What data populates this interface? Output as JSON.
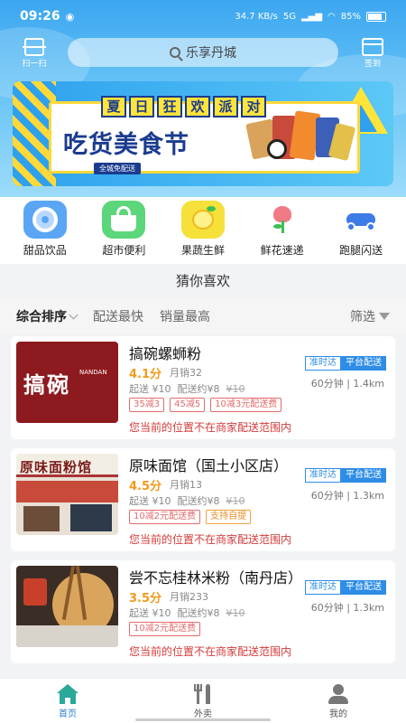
{
  "status": {
    "time": "09:26",
    "speed": "34.7 KB/s",
    "network": "5G",
    "battery": "85%"
  },
  "header": {
    "scan_label": "扫一扫",
    "search_placeholder": "乐享丹城",
    "sign_label": "签到"
  },
  "banner": {
    "summer_chars": [
      "夏",
      "日",
      "狂",
      "欢",
      "派",
      "对"
    ],
    "title": "吃货美食节",
    "tag": "全城免配送"
  },
  "categories": [
    {
      "label": "甜品饮品",
      "icon": "donut-icon",
      "color": "#5aa6f5"
    },
    {
      "label": "超市便利",
      "icon": "basket-icon",
      "color": "#5bd67a"
    },
    {
      "label": "果蔬生鲜",
      "icon": "lemon-icon",
      "color": "#f6e03a"
    },
    {
      "label": "鲜花速递",
      "icon": "flower-icon",
      "color": "#f07a86"
    },
    {
      "label": "跑腿闪送",
      "icon": "scooter-icon",
      "color": "#3d7be8"
    }
  ],
  "section_title": "猜你喜欢",
  "sort": {
    "active": "综合排序",
    "items": [
      "配送最快",
      "销量最高"
    ],
    "filter": "筛选"
  },
  "shops": [
    {
      "name": "搞碗螺蛳粉",
      "score": "4.1分",
      "sales": "月销32",
      "min": "起送 ¥10",
      "fee": "配送约¥8",
      "old_fee": "¥10",
      "tags": [
        {
          "text": "35减3",
          "type": "r"
        },
        {
          "text": "45减5",
          "type": "r"
        },
        {
          "text": "10减3元配送费",
          "type": "r"
        }
      ],
      "badge1": "准时达",
      "badge2": "平台配送",
      "dist": "60分钟 | 1.4km",
      "warn": "您当前的位置不在商家配送范围内",
      "thumb_text": "搞碗",
      "thumb_sub": "NANDAN"
    },
    {
      "name": "原味面馆（国土小区店）",
      "score": "4.5分",
      "sales": "月销13",
      "min": "起送 ¥10",
      "fee": "配送约¥8",
      "old_fee": "¥10",
      "tags": [
        {
          "text": "10减2元配送费",
          "type": "r"
        },
        {
          "text": "支持自提",
          "type": "y"
        }
      ],
      "badge1": "准时达",
      "badge2": "平台配送",
      "dist": "60分钟 | 1.3km",
      "warn": "您当前的位置不在商家配送范围内",
      "thumb_text": "原味面粉馆",
      "thumb_sub": ""
    },
    {
      "name": "尝不忘桂林米粉（南丹店）",
      "score": "3.5分",
      "sales": "月销233",
      "min": "起送 ¥10",
      "fee": "配送约¥8",
      "old_fee": "¥10",
      "tags": [
        {
          "text": "10减2元配送费",
          "type": "r"
        }
      ],
      "badge1": "准时达",
      "badge2": "平台配送",
      "dist": "60分钟 | 1.3km",
      "warn": "您当前的位置不在商家配送范围内",
      "thumb_text": "",
      "thumb_sub": ""
    }
  ],
  "tabs": [
    {
      "label": "首页",
      "icon": "home-icon",
      "active": true
    },
    {
      "label": "外卖",
      "icon": "cutlery-icon",
      "active": false
    },
    {
      "label": "我的",
      "icon": "user-icon",
      "active": false
    }
  ]
}
